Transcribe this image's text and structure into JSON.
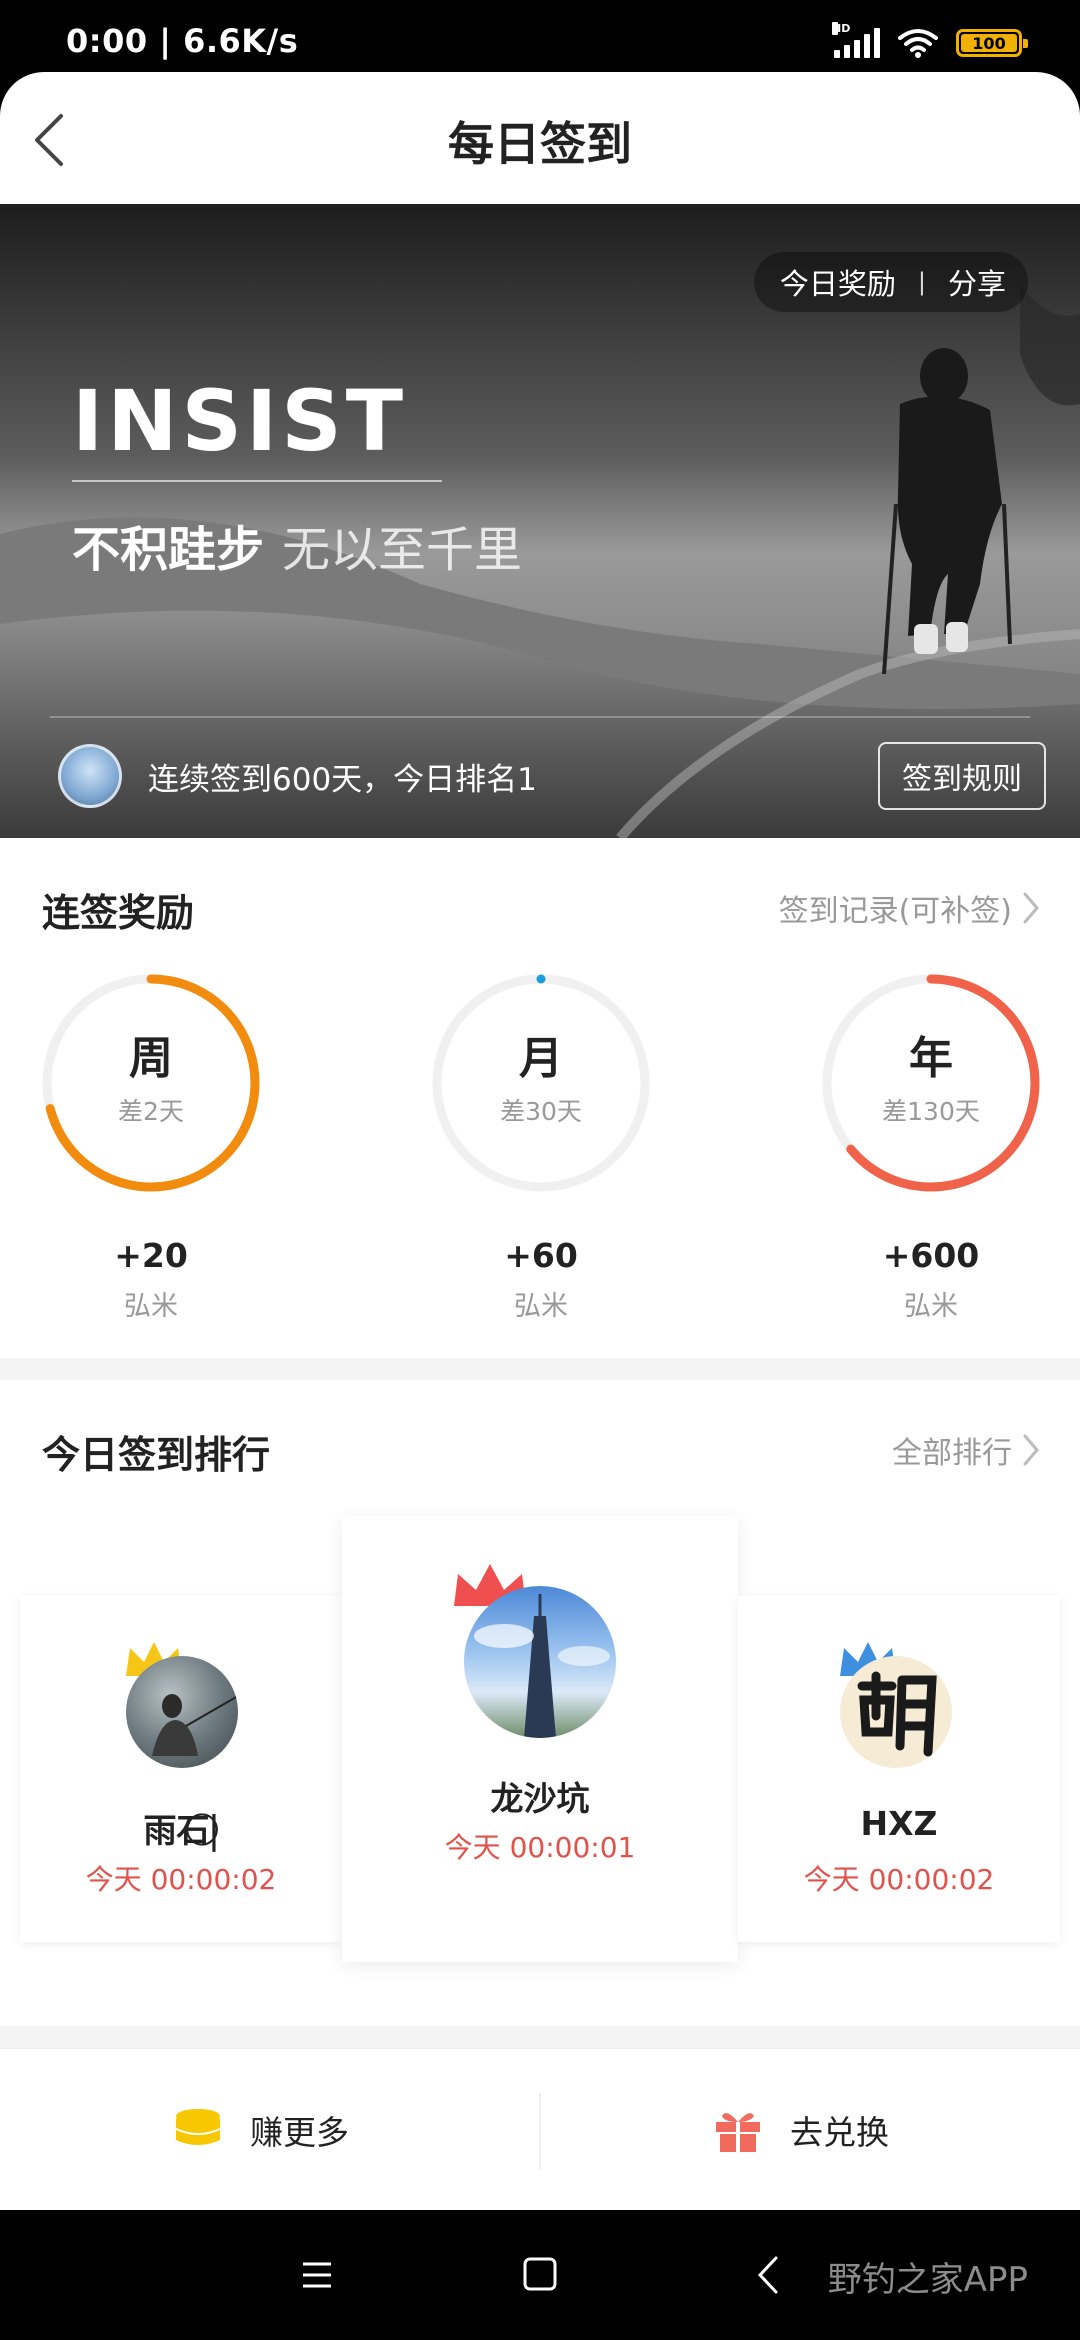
{
  "status_bar": {
    "time_speed": "0:00 | 6.6K/s",
    "network": "HD",
    "battery": "100"
  },
  "header": {
    "title": "每日签到"
  },
  "banner": {
    "today_reward": "今日奖励",
    "divider": "|",
    "share": "分享",
    "headline": "INSIST",
    "slogan_main": "不积跬步",
    "slogan_rest": "无以至千里",
    "streak_text": "连续签到600天，今日排名1",
    "rules_button": "签到规则"
  },
  "rewards": {
    "title": "连签奖励",
    "record_link": "签到记录(可补签)",
    "items": [
      {
        "period": "周",
        "remaining": "差2天",
        "amount": "+20",
        "unit": "弘米",
        "progress": 0.71,
        "color": "#f28c0f"
      },
      {
        "period": "月",
        "remaining": "差30天",
        "amount": "+60",
        "unit": "弘米",
        "progress": 0.0,
        "color": "#1a9ee0"
      },
      {
        "period": "年",
        "remaining": "差130天",
        "amount": "+600",
        "unit": "弘米",
        "progress": 0.64,
        "color": "#f0634a"
      }
    ]
  },
  "ranking": {
    "title": "今日签到排行",
    "all_link": "全部排行",
    "entries": [
      {
        "rank": 2,
        "name": "雨石|⃝",
        "time": "今天 00:00:02",
        "crown_color": "#f5c518"
      },
      {
        "rank": 1,
        "name": "龙沙坑",
        "time": "今天 00:00:01",
        "crown_color": "#ef4f4f"
      },
      {
        "rank": 3,
        "name": "HXZ",
        "time": "今天 00:00:02",
        "crown_color": "#3e8fe0"
      }
    ]
  },
  "actions": {
    "earn_more": "赚更多",
    "redeem": "去兑换"
  },
  "nav_bar": {
    "watermark": "野钓之家APP"
  },
  "colors": {
    "ring_track": "#f0f0f0",
    "rank_time": "#e0524a",
    "coin": "#f7c700",
    "gift": "#f06a5e"
  }
}
